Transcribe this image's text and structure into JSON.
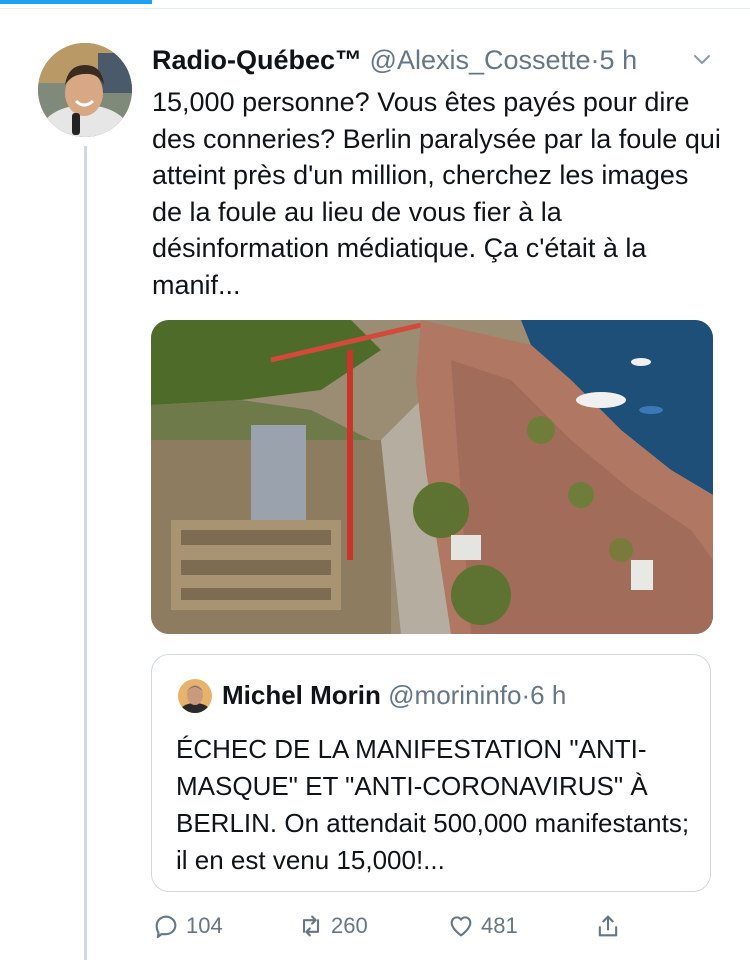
{
  "tweet": {
    "author_name": "Radio-Québec™",
    "handle": "@Alexis_Cossette",
    "dot": "·",
    "time": "5 h",
    "text": "15,000 personne? Vous êtes payés pour dire des conneries? Berlin paralysée par la foule qui atteint près d'un million, cherchez les images de la foule au lieu de vous fier à la désinformation médiatique. Ça c'était à la manif...",
    "actions": {
      "reply_count": "104",
      "retweet_count": "260",
      "like_count": "481"
    }
  },
  "quoted_tweet": {
    "author_name": "Michel Morin",
    "handle": "@morininfo",
    "dot": "·",
    "time": "6 h",
    "text": "ÉCHEC DE LA MANIFESTATION \"ANTI-MASQUE\" ET \"ANTI-CORONAVIRUS\" À BERLIN. On attendait 500,000 manifestants; il en est venu 15,000!..."
  },
  "icons": {
    "more": "chevron-down-icon",
    "reply": "reply-icon",
    "retweet": "retweet-icon",
    "like": "heart-icon",
    "share": "share-icon"
  },
  "colors": {
    "accent": "#1da1f2",
    "secondary_text": "#657786",
    "border": "#cfd9de"
  }
}
